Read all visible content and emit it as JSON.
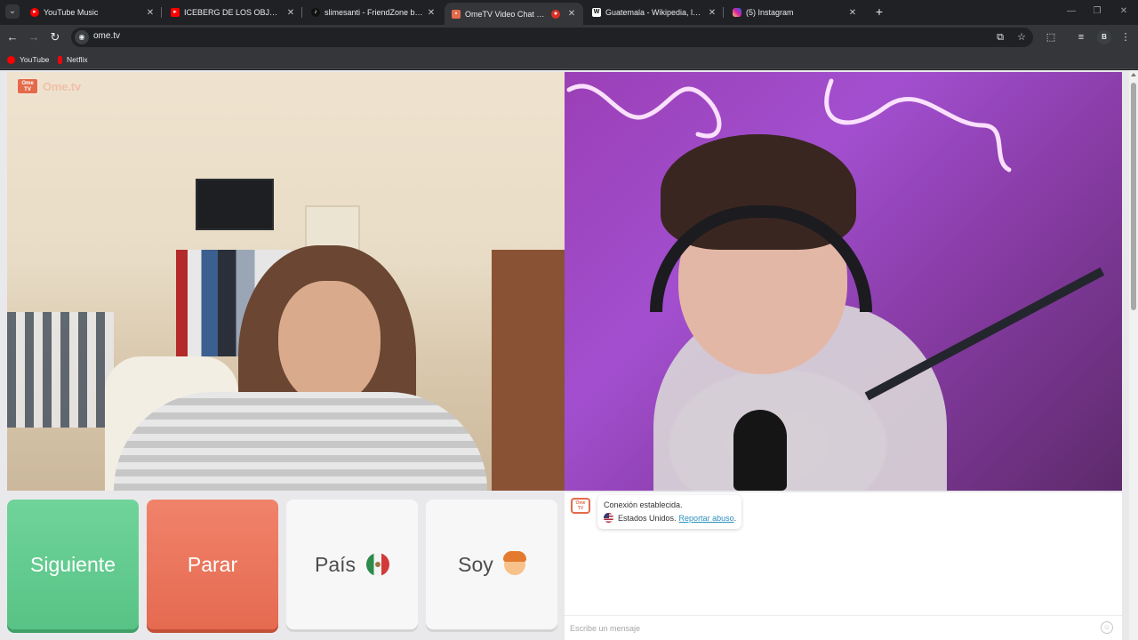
{
  "browser": {
    "tabs": [
      {
        "title": "YouTube Music",
        "favicon": "youtube-music-icon",
        "color": "#ff0000",
        "active": false
      },
      {
        "title": "ICEBERG DE LOS OBJETOS PERD",
        "favicon": "youtube-icon",
        "color": "#ff0000",
        "active": false
      },
      {
        "title": "slimesanti - FriendZone by slim",
        "favicon": "tiktok-icon",
        "color": "#111111",
        "active": false
      },
      {
        "title": "OmeTV Video Chat — Ome",
        "favicon": "ometv-icon",
        "color": "#e36b4b",
        "active": true
      },
      {
        "title": "Guatemala - Wikipedia, la encic",
        "favicon": "wikipedia-icon",
        "color": "#ffffff",
        "active": false
      },
      {
        "title": "(5) Instagram",
        "favicon": "instagram-icon",
        "color": "#d6249f",
        "active": false
      }
    ],
    "url": "ome.tv",
    "profile_initial": "B",
    "bookmarks": [
      {
        "label": "YouTube",
        "color": "#ff0000"
      },
      {
        "label": "Netflix",
        "color": "#e50914"
      }
    ]
  },
  "site": {
    "logo_badge": "Ome TV",
    "logo_text": "Ome.tv"
  },
  "controls": {
    "next_label": "Siguiente",
    "stop_label": "Parar",
    "country_label": "País",
    "country_flag": "mexico-flag-icon",
    "gender_label": "Soy",
    "gender_icon": "boy-face-icon"
  },
  "chat": {
    "status": "Conexión establecida.",
    "country": "Estados Unidos.",
    "report_link": "Reportar abuso",
    "report_suffix": ".",
    "input_placeholder": "Escribe un mensaje"
  },
  "colors": {
    "next": "#5fca8e",
    "stop": "#ea755b",
    "brand": "#e36b4b",
    "link": "#2a8fbd"
  }
}
